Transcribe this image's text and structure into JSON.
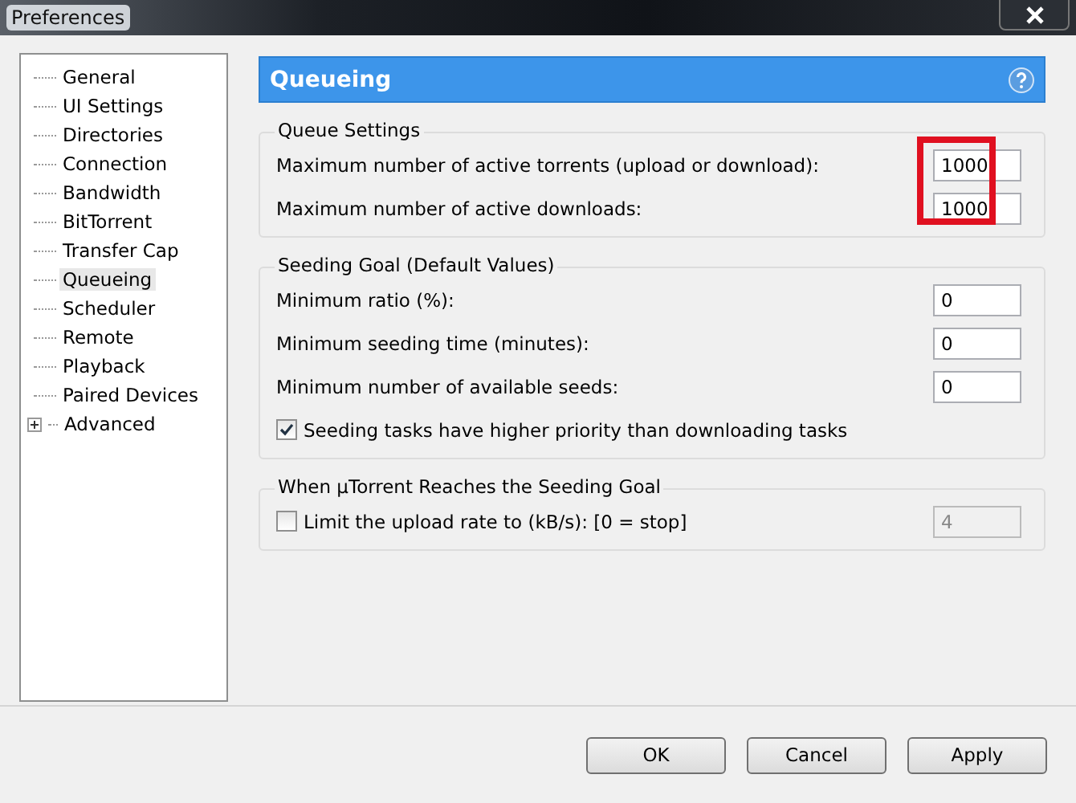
{
  "window": {
    "title": "Preferences"
  },
  "sidebar": {
    "items": [
      {
        "label": "General",
        "selected": false
      },
      {
        "label": "UI Settings",
        "selected": false
      },
      {
        "label": "Directories",
        "selected": false
      },
      {
        "label": "Connection",
        "selected": false
      },
      {
        "label": "Bandwidth",
        "selected": false
      },
      {
        "label": "BitTorrent",
        "selected": false
      },
      {
        "label": "Transfer Cap",
        "selected": false
      },
      {
        "label": "Queueing",
        "selected": true
      },
      {
        "label": "Scheduler",
        "selected": false
      },
      {
        "label": "Remote",
        "selected": false
      },
      {
        "label": "Playback",
        "selected": false
      },
      {
        "label": "Paired Devices",
        "selected": false
      },
      {
        "label": "Advanced",
        "selected": false,
        "expanded": false
      }
    ]
  },
  "panel": {
    "title": "Queueing",
    "groups": [
      {
        "title": "Queue Settings",
        "highlighted": true,
        "rows": [
          {
            "kind": "field",
            "label": "Maximum number of active torrents (upload or download):",
            "value": "1000",
            "disabled": false
          },
          {
            "kind": "field",
            "label": "Maximum number of active downloads:",
            "value": "1000",
            "disabled": false
          }
        ]
      },
      {
        "title": "Seeding Goal (Default Values)",
        "highlighted": false,
        "rows": [
          {
            "kind": "field",
            "label": "Minimum ratio (%):",
            "value": "0",
            "disabled": false
          },
          {
            "kind": "field",
            "label": "Minimum seeding time (minutes):",
            "value": "0",
            "disabled": false
          },
          {
            "kind": "field",
            "label": "Minimum number of available seeds:",
            "value": "0",
            "disabled": false
          },
          {
            "kind": "checkbox",
            "label": "Seeding tasks have higher priority than downloading tasks",
            "checked": true
          }
        ]
      },
      {
        "title": "When µTorrent Reaches the Seeding Goal",
        "highlighted": false,
        "rows": [
          {
            "kind": "checkfield",
            "label": "Limit the upload rate to (kB/s): [0 = stop]",
            "checked": false,
            "value": "4",
            "disabled": true
          }
        ]
      }
    ]
  },
  "buttons": [
    "OK",
    "Cancel",
    "Apply"
  ]
}
